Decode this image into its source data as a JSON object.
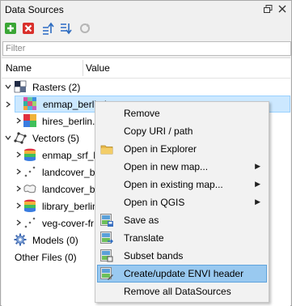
{
  "panel": {
    "title": "Data Sources",
    "float_icon": "restore-window-icon",
    "close_icon": "close-icon"
  },
  "toolbar": {
    "buttons": [
      "add-datasource-icon",
      "remove-datasource-icon",
      "collapse-all-icon",
      "expand-all-icon",
      "refresh-icon"
    ]
  },
  "filter": {
    "placeholder": "Filter",
    "value": ""
  },
  "tree": {
    "columns": [
      "Name",
      "Value"
    ],
    "items": [
      {
        "label": "Rasters (2)",
        "icon": "raster-group-icon",
        "expanded": true
      },
      {
        "label": "enmap_berlin.bsq",
        "icon": "raster-image-icon",
        "selected": true
      },
      {
        "label": "hires_berlin.bsq",
        "icon": "raster-image-icon"
      },
      {
        "label": "Vectors (5)",
        "icon": "vector-group-icon",
        "expanded": true
      },
      {
        "label": "enmap_srf_li",
        "icon": "spectral-library-icon"
      },
      {
        "label": "landcover_be",
        "icon": "point-layer-icon"
      },
      {
        "label": "landcover_be",
        "icon": "polygon-layer-icon"
      },
      {
        "label": "library_berlin",
        "icon": "spectral-library-icon"
      },
      {
        "label": "veg-cover-fr",
        "icon": "point-layer-icon"
      },
      {
        "label": "Models (0)",
        "icon": "models-gear-icon"
      },
      {
        "label": "Other Files (0)",
        "icon": ""
      }
    ]
  },
  "context_menu": {
    "items": [
      {
        "label": "Remove",
        "icon": "",
        "submenu": false
      },
      {
        "label": "Copy URI / path",
        "icon": "",
        "submenu": false
      },
      {
        "label": "Open in Explorer",
        "icon": "folder-icon",
        "submenu": false
      },
      {
        "label": "Open in new map...",
        "icon": "",
        "submenu": true
      },
      {
        "label": "Open in existing map...",
        "icon": "",
        "submenu": true
      },
      {
        "label": "Open in QGIS",
        "icon": "",
        "submenu": true
      },
      {
        "label": "Save as",
        "icon": "raster-save-icon",
        "submenu": false
      },
      {
        "label": "Translate",
        "icon": "raster-translate-icon",
        "submenu": false
      },
      {
        "label": "Subset bands",
        "icon": "raster-subset-icon",
        "submenu": false
      },
      {
        "label": "Create/update ENVI header",
        "icon": "raster-header-icon",
        "submenu": false,
        "highlighted": true
      },
      {
        "label": "Remove all DataSources",
        "icon": "",
        "submenu": false
      }
    ]
  },
  "colors": {
    "selection": "#cce8ff",
    "menu_highlight": "#99c9f0",
    "add_green": "#3aa635",
    "remove_red": "#d9302b"
  }
}
